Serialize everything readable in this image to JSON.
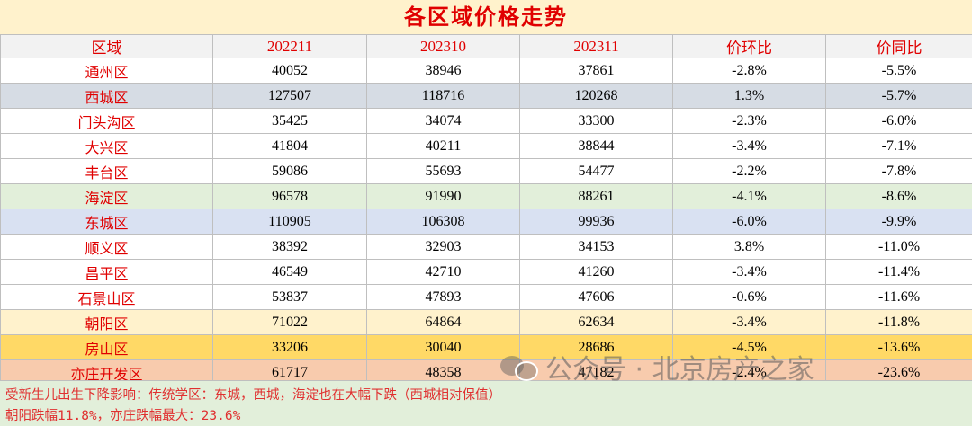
{
  "title": "各区域价格走势",
  "headers": [
    "区域",
    "202211",
    "202310",
    "202311",
    "价环比",
    "价同比"
  ],
  "rows": [
    {
      "district": "通州区",
      "v1": "40052",
      "v2": "38946",
      "v3": "37861",
      "mom": "-2.8%",
      "yoy": "-5.5%"
    },
    {
      "district": "西城区",
      "v1": "127507",
      "v2": "118716",
      "v3": "120268",
      "mom": "1.3%",
      "yoy": "-5.7%"
    },
    {
      "district": "门头沟区",
      "v1": "35425",
      "v2": "34074",
      "v3": "33300",
      "mom": "-2.3%",
      "yoy": "-6.0%"
    },
    {
      "district": "大兴区",
      "v1": "41804",
      "v2": "40211",
      "v3": "38844",
      "mom": "-3.4%",
      "yoy": "-7.1%"
    },
    {
      "district": "丰台区",
      "v1": "59086",
      "v2": "55693",
      "v3": "54477",
      "mom": "-2.2%",
      "yoy": "-7.8%"
    },
    {
      "district": "海淀区",
      "v1": "96578",
      "v2": "91990",
      "v3": "88261",
      "mom": "-4.1%",
      "yoy": "-8.6%"
    },
    {
      "district": "东城区",
      "v1": "110905",
      "v2": "106308",
      "v3": "99936",
      "mom": "-6.0%",
      "yoy": "-9.9%"
    },
    {
      "district": "顺义区",
      "v1": "38392",
      "v2": "32903",
      "v3": "34153",
      "mom": "3.8%",
      "yoy": "-11.0%"
    },
    {
      "district": "昌平区",
      "v1": "46549",
      "v2": "42710",
      "v3": "41260",
      "mom": "-3.4%",
      "yoy": "-11.4%"
    },
    {
      "district": "石景山区",
      "v1": "53837",
      "v2": "47893",
      "v3": "47606",
      "mom": "-0.6%",
      "yoy": "-11.6%"
    },
    {
      "district": "朝阳区",
      "v1": "71022",
      "v2": "64864",
      "v3": "62634",
      "mom": "-3.4%",
      "yoy": "-11.8%"
    },
    {
      "district": "房山区",
      "v1": "33206",
      "v2": "30040",
      "v3": "28686",
      "mom": "-4.5%",
      "yoy": "-13.6%"
    },
    {
      "district": "亦庄开发区",
      "v1": "61717",
      "v2": "48358",
      "v3": "47182",
      "mom": "-2.4%",
      "yoy": "-23.6%"
    }
  ],
  "notes": {
    "line1": "受新生儿出生下降影响：传统学区：东城，西城，海淀也在大幅下跌（西城相对保值）",
    "line2": "朝阳跌幅11.8%，亦庄跌幅最大：23.6%"
  },
  "watermark": {
    "text": "公众号 · 北京房产之家",
    "icon": "wechat-icon"
  },
  "colors": {
    "title_bg": "#fff2cc",
    "accent": "#e00000",
    "notes_bg": "#e2efda"
  }
}
